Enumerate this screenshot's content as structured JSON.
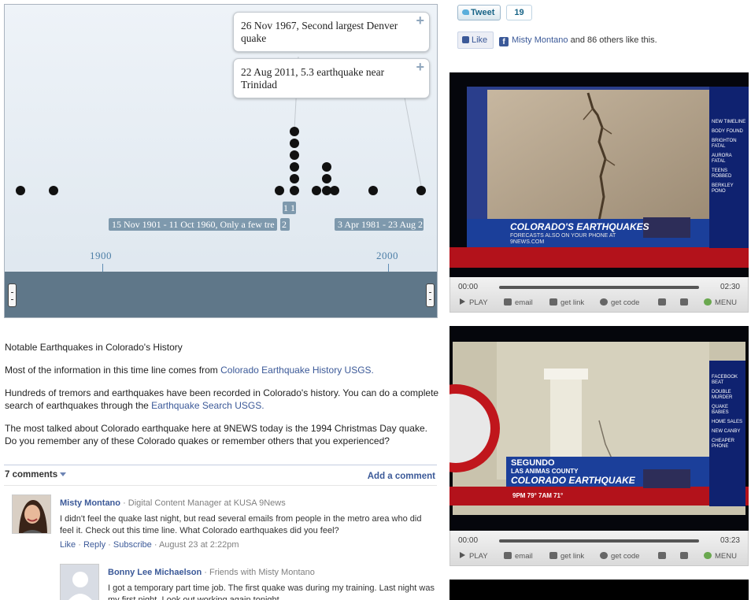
{
  "timeline": {
    "bubbles": [
      {
        "text": "26 Nov 1967, Second largest Denver quake"
      },
      {
        "text": "22 Aug 2011, 5.3 earthquake near Trinidad"
      }
    ],
    "bands": [
      {
        "label": "15 Nov 1901 - 11 Oct 1960, Only a few tre"
      },
      {
        "label": "2"
      },
      {
        "label": "1 1"
      },
      {
        "label": "3 Apr 1981 - 23 Aug 2"
      }
    ],
    "ticks": [
      "1900",
      "2000"
    ],
    "events": [
      {
        "stack": 1
      },
      {
        "stack": 1
      },
      {
        "stack": 1
      },
      {
        "stack": 6
      },
      {
        "stack": 1
      },
      {
        "stack": 3
      },
      {
        "stack": 1
      },
      {
        "stack": 1
      },
      {
        "stack": 1
      }
    ]
  },
  "article": {
    "heading": "Notable Earthquakes in Colorado's History",
    "p1_text": "Most of the information in this time line comes from ",
    "p1_link": "Colorado Earthquake History USGS.",
    "p2_text": "Hundreds of tremors and earthquakes have been recorded in Colorado's history. You can do a complete search of earthquakes through the ",
    "p2_link": "Earthquake Search USGS.",
    "p3_text": "The most talked about Colorado earthquake here at 9NEWS today is the 1994 Christmas Day quake. Do you remember any of these Colorado quakes or remember others that you experienced?"
  },
  "comments": {
    "count_label": "7 comments",
    "add_label": "Add a comment",
    "items": [
      {
        "name": "Misty Montano",
        "meta": "· Digital Content Manager at KUSA 9News",
        "text": "I didn't feel the quake last night, but read several emails from people in the metro area who did feel it. Check out this time line. What Colorado earthquakes did you feel?",
        "like": "Like",
        "reply": "Reply",
        "subscribe": "Subscribe",
        "date": "· August 23 at 2:22pm"
      },
      {
        "name": "Bonny Lee Michaelson",
        "meta": "· Friends with Misty Montano",
        "text": "I got a temporary part time job. The first quake was during my training. Last night was my first night. Look out working again tonight."
      }
    ]
  },
  "social": {
    "tweet_label": "Tweet",
    "tweet_count": "19",
    "like_label": "Like",
    "like_name": "Misty Montano",
    "like_rest": " and 86 others like this."
  },
  "videos": [
    {
      "headline": "COLORADO'S EARTHQUAKES",
      "subline": "FORECASTS ALSO ON YOUR PHONE AT 9NEWS.COM",
      "ticker": [
        "NEW TIMELINE",
        "BODY FOUND",
        "BRIGHTON FATAL",
        "AURORA FATAL",
        "TEENS ROBBED",
        "BERKLEY PONO"
      ],
      "time_start": "00:00",
      "time_end": "02:30"
    },
    {
      "headline": "COLORADO EARTHQUAKE",
      "place": "SEGUNDO",
      "subplace": "LAS ANIMAS COUNTY",
      "weather": "9PM  79°  7AM  71°",
      "ticker": [
        "FACEBOOK BEAT",
        "DOUBLE MURDER",
        "QUAKE BABIES",
        "HOME SALES",
        "NEW CANBY",
        "CHEAPER PHONE"
      ],
      "time_start": "00:00",
      "time_end": "03:23"
    }
  ],
  "video_controls": {
    "play": "PLAY",
    "email": "email",
    "link": "get link",
    "code": "get code",
    "menu": "MENU"
  },
  "colors": {
    "link": "#3b5998",
    "timeline_band": "#7e99ad",
    "timeline_axis": "#5f8cb3",
    "news_red": "#b3121b",
    "news_blue": "#1b3f9a"
  }
}
